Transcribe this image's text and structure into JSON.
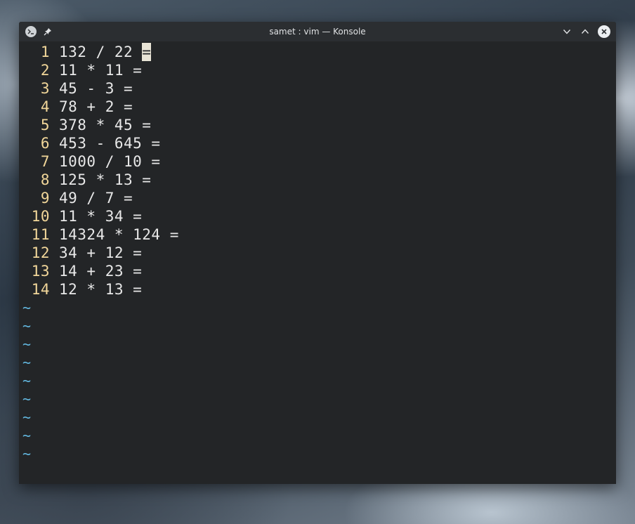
{
  "window": {
    "title": "samet : vim — Konsole",
    "icons": {
      "app": "terminal-icon",
      "pin": "pin-icon",
      "minimize": "chevron-down-icon",
      "maximize": "chevron-up-icon",
      "close": "close-icon"
    }
  },
  "editor": {
    "lines": [
      {
        "number": "1",
        "text": "132 / 22 ",
        "cursor": "="
      },
      {
        "number": "2",
        "text": "11 * 11 ="
      },
      {
        "number": "3",
        "text": "45 - 3 ="
      },
      {
        "number": "4",
        "text": "78 + 2 ="
      },
      {
        "number": "5",
        "text": "378 * 45 ="
      },
      {
        "number": "6",
        "text": "453 - 645 ="
      },
      {
        "number": "7",
        "text": "1000 / 10 ="
      },
      {
        "number": "8",
        "text": "125 * 13 ="
      },
      {
        "number": "9",
        "text": "49 / 7 ="
      },
      {
        "number": "10",
        "text": "11 * 34 ="
      },
      {
        "number": "11",
        "text": "14324 * 124 ="
      },
      {
        "number": "12",
        "text": "34 + 12 ="
      },
      {
        "number": "13",
        "text": "14 + 23 ="
      },
      {
        "number": "14",
        "text": "12 * 13 ="
      }
    ],
    "empty_markers": [
      "~",
      "~",
      "~",
      "~",
      "~",
      "~",
      "~",
      "~",
      "~"
    ]
  },
  "colors": {
    "line_number": "#f2d79a",
    "text": "#e8e8e8",
    "tilde": "#63b8e0",
    "background": "#232528"
  }
}
